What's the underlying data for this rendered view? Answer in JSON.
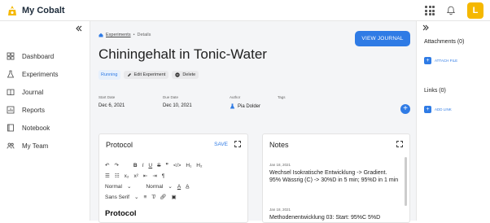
{
  "app": {
    "name": "My Cobalt",
    "avatar_letter": "L"
  },
  "sidebar": {
    "items": [
      {
        "label": "Dashboard",
        "icon": "dashboard-icon"
      },
      {
        "label": "Experiments",
        "icon": "flask-icon"
      },
      {
        "label": "Journal",
        "icon": "book-icon"
      },
      {
        "label": "Reports",
        "icon": "chart-icon"
      },
      {
        "label": "Notebook",
        "icon": "notebook-icon"
      },
      {
        "label": "My Team",
        "icon": "team-icon"
      }
    ]
  },
  "breadcrumb": {
    "link": "Experiments",
    "sep": "•",
    "current": "Details"
  },
  "page": {
    "title": "Chiningehalt in Tonic-Water",
    "view_journal": "VIEW JOURNAL"
  },
  "status": "Running",
  "actions": {
    "edit": "Edit Experiment",
    "delete": "Delete"
  },
  "meta": {
    "start_label": "Start Date",
    "start_value": "Dec 6, 2021",
    "due_label": "Due Date",
    "due_value": "Dec 10, 2021",
    "author_label": "Author",
    "author_value": "Pia Dolder",
    "tags_label": "Tags"
  },
  "protocol": {
    "title": "Protocol",
    "save": "SAVE",
    "toolbar": {
      "normal1": "Normal",
      "normal2": "Normal",
      "font": "Sans Serif"
    },
    "heading": "Protocol"
  },
  "notes": {
    "title": "Notes",
    "items": [
      {
        "date": "Jan 18, 2021",
        "text": "Wechsel Isokratische Entwicklung -> Gradient. 95% Wässrig (C) -> 30%D in 5 min; 95%D in 1 min"
      },
      {
        "date": "Jan 18, 2021",
        "text": "Methodenentwicklung 03: Start: 95%C 5%D"
      }
    ]
  },
  "right": {
    "attachments": "Attachments (0)",
    "attach_file": "ATTACH FILE",
    "links": "Links (0)",
    "add_link": "ADD LINK"
  },
  "colors": {
    "accent": "#2f7be5",
    "avatar": "#f5b800"
  }
}
